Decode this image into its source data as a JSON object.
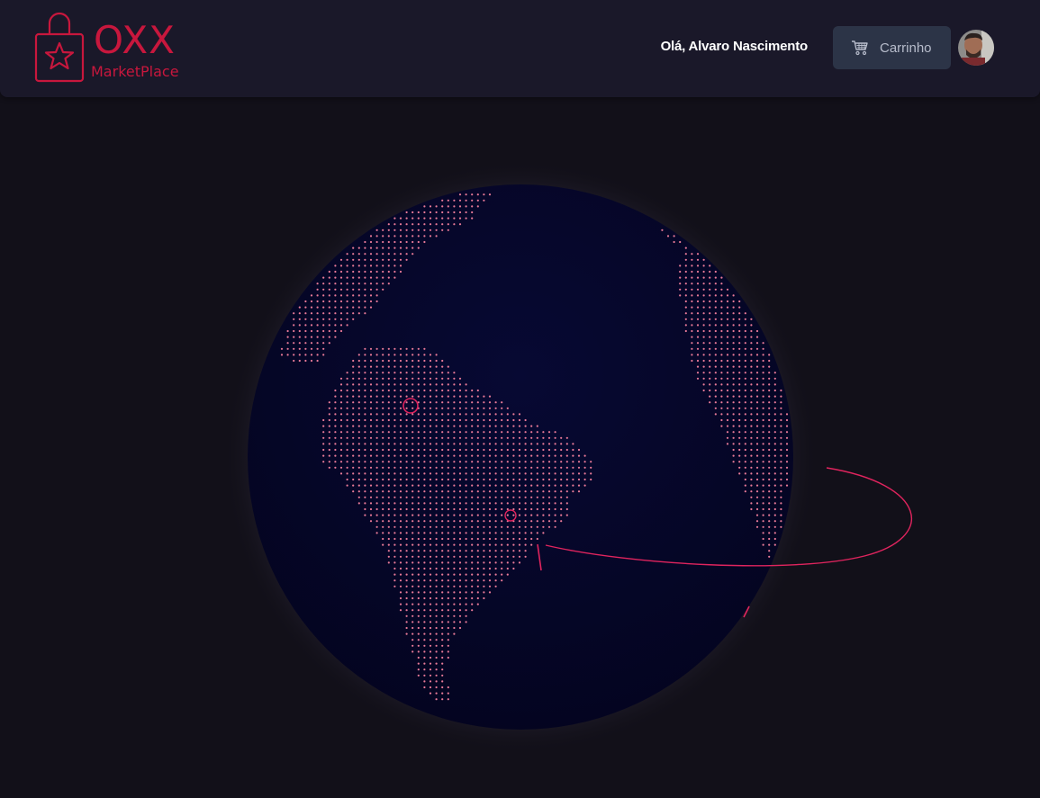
{
  "header": {
    "logo": {
      "title": "OXX",
      "subtitle": "MarketPlace",
      "icon": "shopping-bag-star-icon",
      "color": "#c8173d"
    },
    "greeting": "Olá, Alvaro Nascimento",
    "cart": {
      "label": "Carrinho",
      "icon": "cart-icon"
    },
    "avatar": {
      "icon": "user-avatar"
    }
  },
  "globe": {
    "ocean_color": "#050627",
    "dot_color": "#e97a98",
    "arc_color": "#e0245e",
    "markers": 2,
    "arcs": 1
  },
  "colors": {
    "background": "#121019",
    "header": "#1a1829",
    "cart_button": "#2c3447",
    "accent": "#c8173d"
  }
}
